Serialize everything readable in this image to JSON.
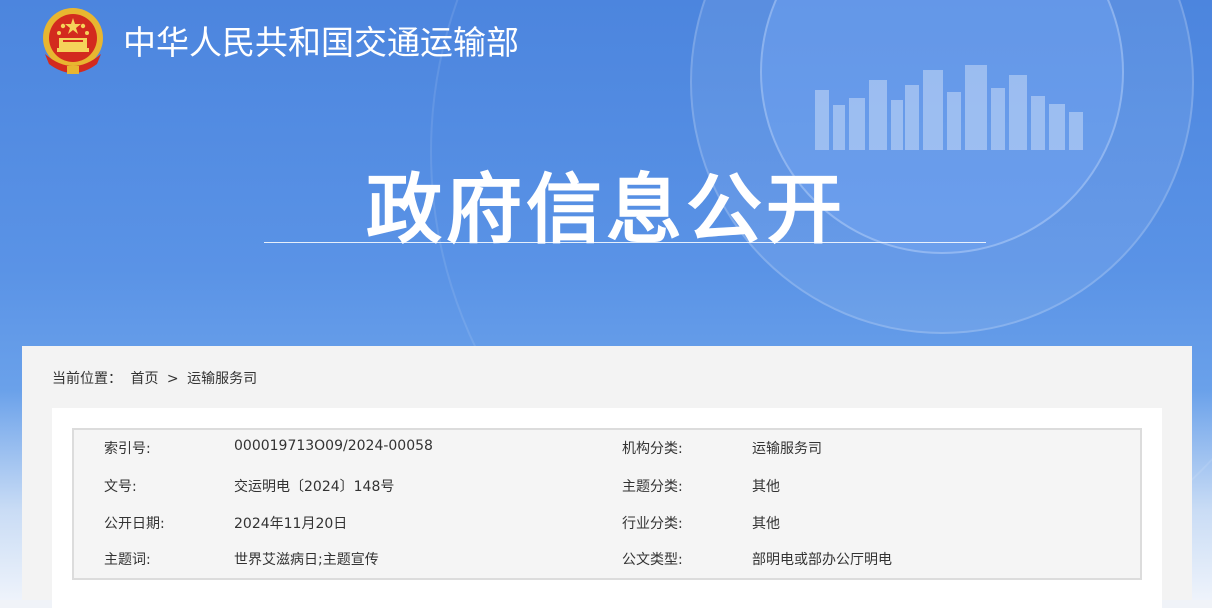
{
  "header": {
    "ministry_name": "中华人民共和国交通运输部",
    "page_title": "政府信息公开"
  },
  "breadcrumb": {
    "label": "当前位置：",
    "home": "首页",
    "separator": ">",
    "current": "运输服务司"
  },
  "info": {
    "rows": [
      {
        "label_left": "索引号:",
        "value_left": "000019713O09/2024-00058",
        "label_right": "机构分类:",
        "value_right": "运输服务司"
      },
      {
        "label_left": "文号:",
        "value_left": "交运明电〔2024〕148号",
        "label_right": "主题分类:",
        "value_right": "其他"
      },
      {
        "label_left": "公开日期:",
        "value_left": "2024年11月20日",
        "label_right": "行业分类:",
        "value_right": "其他"
      },
      {
        "label_left": "主题词:",
        "value_left": "世界艾滋病日;主题宣传",
        "label_right": "公文类型:",
        "value_right": "部明电或部办公厅明电"
      }
    ]
  },
  "colors": {
    "header_blue": "#4c85de",
    "panel_bg": "#f3f3f3",
    "info_border": "#dcdcdc"
  },
  "icons": {
    "emblem": "national-emblem-icon"
  }
}
